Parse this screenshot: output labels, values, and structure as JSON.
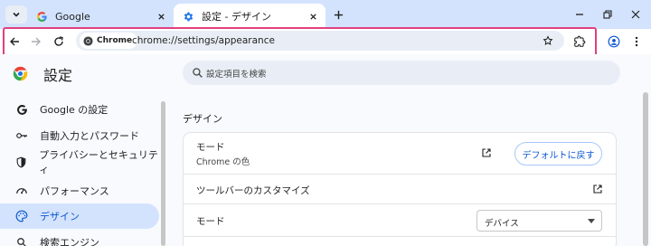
{
  "tabs": [
    {
      "title": "Google",
      "active": false
    },
    {
      "title": "設定 - デザイン",
      "active": true
    }
  ],
  "address_bar": {
    "site_chip": "Chrome",
    "url": "chrome://settings/appearance"
  },
  "settings": {
    "title": "設定",
    "search_placeholder": "設定項目を検索"
  },
  "sidebar": {
    "items": [
      {
        "label": "Google の設定",
        "icon": "google-g-icon",
        "selected": false
      },
      {
        "label": "自動入力とパスワード",
        "icon": "key-icon",
        "selected": false
      },
      {
        "label": "プライバシーとセキュリティ",
        "icon": "shield-icon",
        "selected": false
      },
      {
        "label": "パフォーマンス",
        "icon": "speedometer-icon",
        "selected": false
      },
      {
        "label": "デザイン",
        "icon": "palette-icon",
        "selected": true
      },
      {
        "label": "検索エンジン",
        "icon": "search-icon",
        "selected": false
      }
    ]
  },
  "main": {
    "section_title": "デザイン",
    "theme_row": {
      "label": "モード",
      "sublabel": "Chrome の色",
      "reset_label": "デフォルトに戻す"
    },
    "toolbar_customize_row": {
      "label": "ツールバーのカスタマイズ"
    },
    "mode_row": {
      "label": "モード",
      "selected_value": "デバイス"
    }
  },
  "colors": {
    "tabstrip": "#d3e3fd",
    "accent": "#0b57d0",
    "highlight_border": "#e0407f",
    "selected_nav": "#d3e3fd"
  }
}
